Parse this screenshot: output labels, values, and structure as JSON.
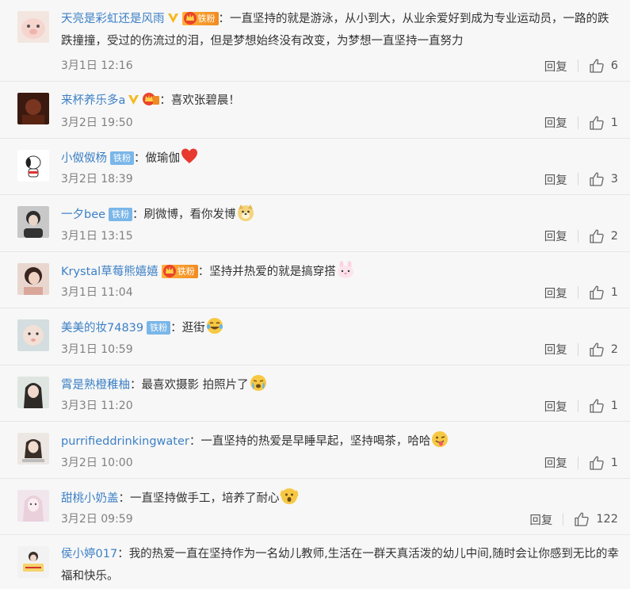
{
  "comments": [
    {
      "username": "天亮是彩虹还是风雨",
      "verified": true,
      "fan_badge": {
        "type": "gold",
        "label": "铁粉"
      },
      "separator": "：",
      "text": "一直坚持的就是游泳，从小到大，从业余爱好到成为专业运动员，一路的跌跌撞撞，受过的伤流过的泪，但是梦想始终没有改变，为梦想一直坚持一直努力",
      "time": "3月1日 12:16",
      "reply_label": "回复",
      "likes": "6",
      "avatar_icon": "pig-face-avatar"
    },
    {
      "username": "来杯养乐多a",
      "verified": true,
      "fan_badge": {
        "type": "gold-small",
        "label": ""
      },
      "separator": "：",
      "text": "喜欢张碧晨！",
      "time": "3月2日 19:50",
      "reply_label": "回复",
      "likes": "1",
      "avatar_icon": "dark-photo-avatar"
    },
    {
      "username": "小伮伮杨",
      "verified": false,
      "fan_badge": {
        "type": "iron",
        "label": "铁粉"
      },
      "separator": "：",
      "text": "做瑜伽",
      "emoji": "heart-emoji",
      "time": "3月2日 18:39",
      "reply_label": "回复",
      "likes": "3",
      "avatar_icon": "snoopy-avatar"
    },
    {
      "username": "一夕bee",
      "verified": false,
      "fan_badge": {
        "type": "iron",
        "label": "铁粉"
      },
      "separator": "：",
      "text": "刷微博，看你发博",
      "emoji": "doge-emoji",
      "time": "3月1日 13:15",
      "reply_label": "回复",
      "likes": "2",
      "avatar_icon": "person-avatar"
    },
    {
      "username": "Krystal草莓熊嬉嬉",
      "verified": false,
      "fan_badge": {
        "type": "gold",
        "label": "铁粉"
      },
      "separator": "：",
      "text": "坚持并热爱的就是搞穿搭",
      "emoji": "bunny-emoji",
      "time": "3月1日 11:04",
      "reply_label": "回复",
      "likes": "1",
      "avatar_icon": "girl-avatar"
    },
    {
      "username": "美美的妆74839",
      "verified": false,
      "fan_badge": {
        "type": "iron",
        "label": "铁粉"
      },
      "separator": "：",
      "text": "逛街",
      "emoji": "laugh-cry-emoji",
      "time": "3月1日 10:59",
      "reply_label": "回复",
      "likes": "2",
      "avatar_icon": "baby-avatar"
    },
    {
      "username": "霄是熟橙稚柚",
      "verified": false,
      "fan_badge": null,
      "separator": "：",
      "text": "最喜欢摄影 拍照片了",
      "emoji": "tears-emoji",
      "time": "3月3日 11:20",
      "reply_label": "回复",
      "likes": "1",
      "avatar_icon": "woman-avatar"
    },
    {
      "username": "purrifieddrinkingwater",
      "verified": false,
      "fan_badge": null,
      "separator": "：",
      "text": "一直坚持的热爱是早睡早起，坚持喝茶，哈哈",
      "emoji": "tongue-emoji",
      "time": "3月2日 10:00",
      "reply_label": "回复",
      "likes": "1",
      "avatar_icon": "portrait-avatar"
    },
    {
      "username": "甜桃小奶盖",
      "verified": false,
      "fan_badge": null,
      "separator": "：",
      "text": "一直坚持做手工，培养了耐心",
      "emoji": "shocked-emoji",
      "time": "3月2日 09:59",
      "reply_label": "回复",
      "likes": "122",
      "avatar_icon": "pink-girl-avatar"
    },
    {
      "username": "侯小婷017",
      "verified": false,
      "fan_badge": null,
      "separator": "：",
      "text": "我的热爱一直在坚持作为一名幼儿教师,生活在一群天真活泼的幼儿中间,随时会让你感到无比的幸福和快乐。",
      "avatar_icon": "sign-avatar"
    }
  ],
  "colors": {
    "username": "#3d80c6",
    "verified": "#f6b91c",
    "iron_badge": "#7ab6e8",
    "gold_badge": "#f08b22",
    "meta": "#808080"
  }
}
